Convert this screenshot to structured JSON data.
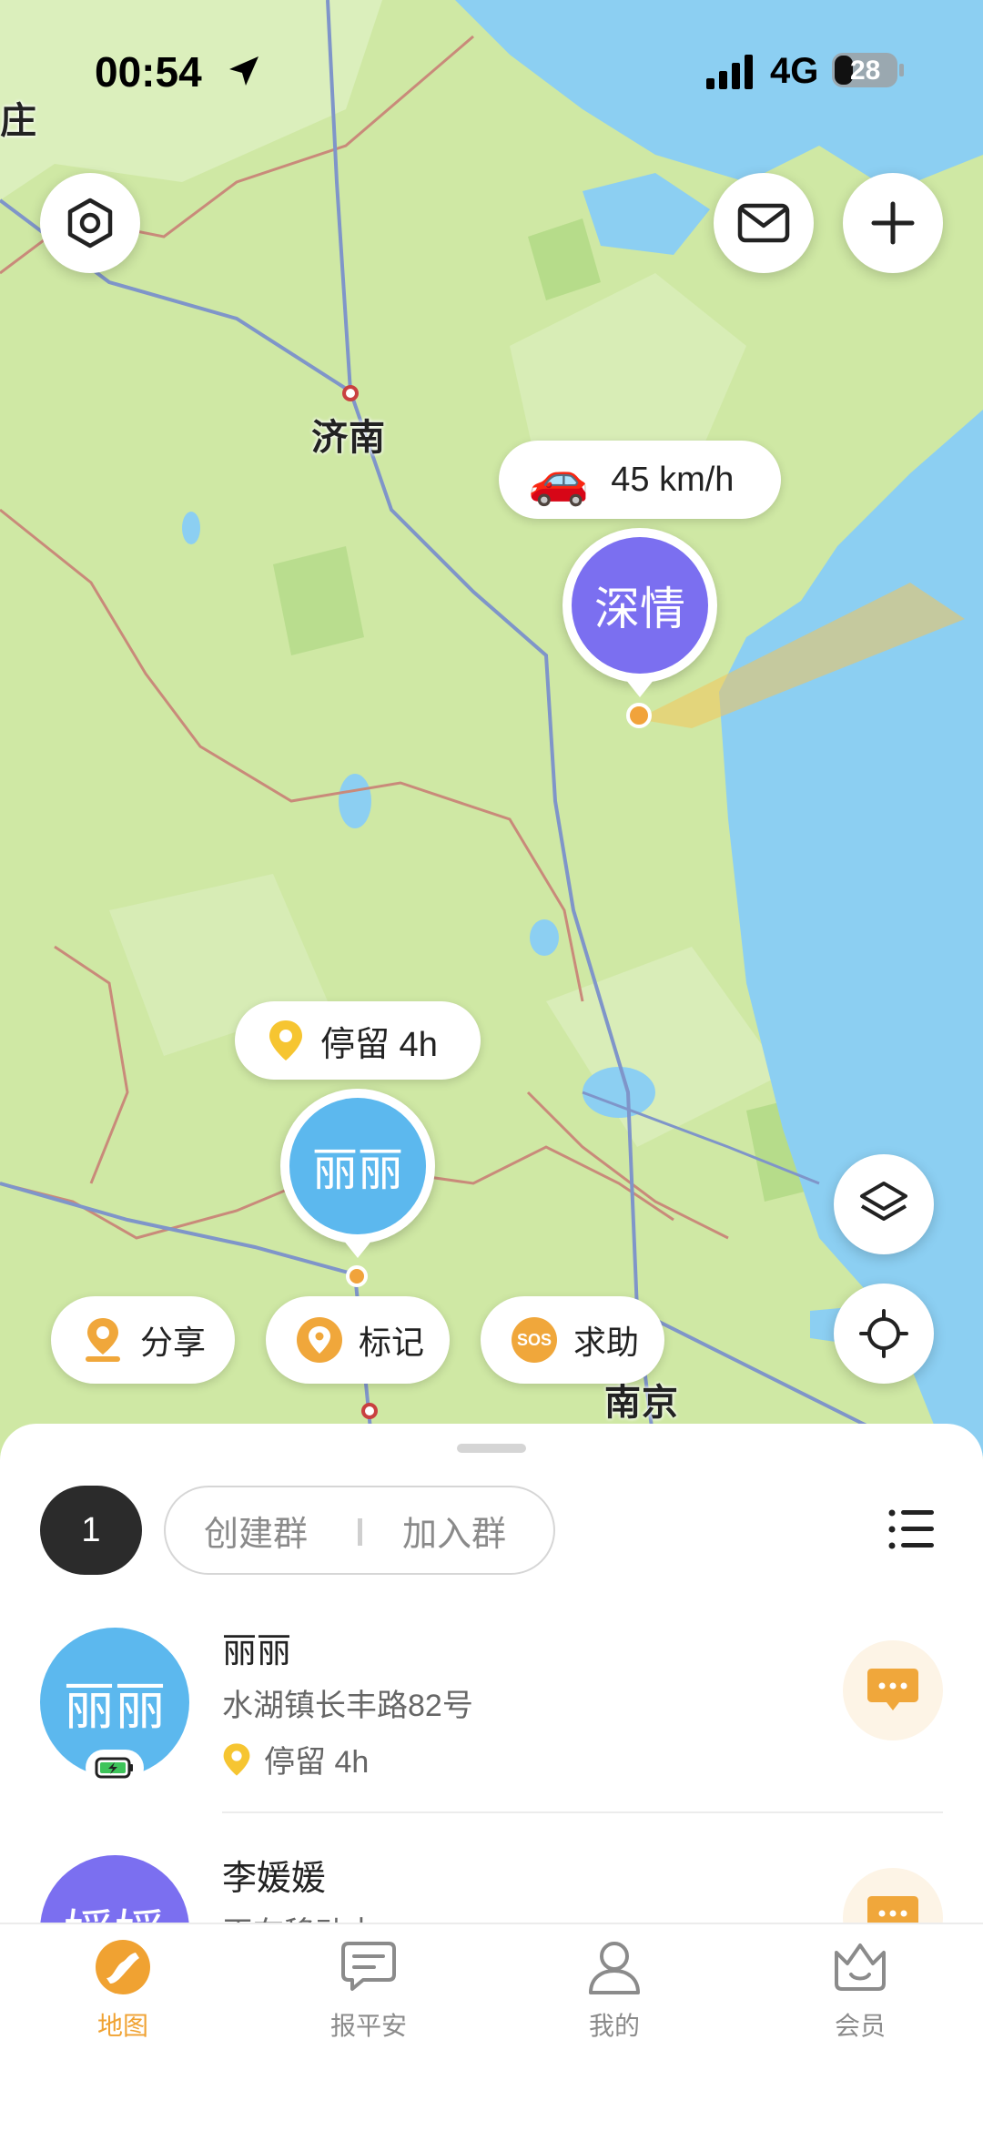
{
  "status_bar": {
    "time": "00:54",
    "network": "4G",
    "battery": "28"
  },
  "map": {
    "cities": [
      {
        "name": "济南"
      },
      {
        "name": "南京"
      },
      {
        "name": "庄"
      }
    ],
    "members_on_map": [
      {
        "name": "深情",
        "avatar_color": "#7b6ff0",
        "badge_text": "45 km/h",
        "badge_icon": "car-icon"
      },
      {
        "name": "丽丽",
        "avatar_color": "#5cb8ee",
        "badge_text": "停留 4h",
        "badge_icon": "location-pin-icon"
      }
    ],
    "actions": [
      {
        "label": "分享",
        "icon": "share-location-icon"
      },
      {
        "label": "标记",
        "icon": "mark-pin-icon"
      },
      {
        "label": "求助",
        "icon": "sos-icon"
      }
    ]
  },
  "sheet": {
    "member_count": "1",
    "create_group": "创建群",
    "join_group": "加入群",
    "members": [
      {
        "name": "丽丽",
        "avatar_text": "丽丽",
        "avatar_color": "#5cb8ee",
        "address": "水湖镇长丰路82号",
        "status": "停留 4h"
      },
      {
        "name": "李媛媛",
        "avatar_text": "媛媛",
        "avatar_color": "#7b6ff0",
        "address": "正在移动中",
        "status": ""
      }
    ]
  },
  "tabs": [
    {
      "label": "地图",
      "icon": "map-icon",
      "active": true
    },
    {
      "label": "报平安",
      "icon": "chat-report-icon",
      "active": false
    },
    {
      "label": "我的",
      "icon": "person-icon",
      "active": false
    },
    {
      "label": "会员",
      "icon": "crown-icon",
      "active": false
    }
  ],
  "colors": {
    "accent": "#f0a232",
    "map_land": "#cfe8a4",
    "map_water": "#8ccff2"
  }
}
